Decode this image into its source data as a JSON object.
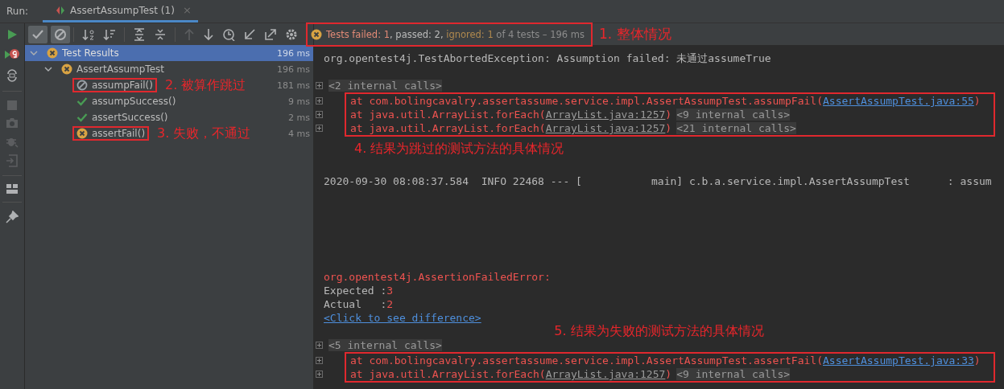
{
  "run_bar": {
    "label": "Run:",
    "tabs": [
      {
        "title": "AssertAssumpTest (1)",
        "close": "×",
        "selected": true
      }
    ]
  },
  "summary": {
    "framed": true,
    "segments": [
      {
        "kind": "failed",
        "text": "Tests failed: 1"
      },
      {
        "kind": "passed",
        "text": ", passed: 2,"
      },
      {
        "kind": "ignored",
        "text": " ignored: 1"
      },
      {
        "kind": "muted",
        "text": " of 4 tests – 196 ms"
      }
    ],
    "note": "1. 整体情况"
  },
  "toolbar": {
    "show_passed": true,
    "show_ignored": true
  },
  "tree": [
    {
      "name": "Test Results",
      "time": "196 ms",
      "kind": "failed",
      "selected": true,
      "expanded": true,
      "framed": false,
      "children": [
        {
          "name": "AssertAssumpTest",
          "time": "196 ms",
          "kind": "failed",
          "selected": false,
          "expanded": true,
          "framed": false,
          "children": [
            {
              "name": "assumpFail()",
              "time": "181 ms",
              "kind": "ignored",
              "selected": false,
              "framed": true,
              "note": "2. 被算作跳过"
            },
            {
              "name": "assumpSuccess()",
              "time": "9 ms",
              "kind": "passed",
              "selected": false,
              "framed": false
            },
            {
              "name": "assertSuccess()",
              "time": "2 ms",
              "kind": "passed",
              "selected": false,
              "framed": false
            },
            {
              "name": "assertFail()",
              "time": "4 ms",
              "kind": "failed",
              "selected": false,
              "framed": true,
              "note": "3. 失败，不通过"
            }
          ]
        }
      ]
    }
  ],
  "console": [
    {
      "kind": "line",
      "fold": false,
      "segments": [
        {
          "kind": "plain",
          "text": "org.opentest4j.TestAbortedException: Assumption failed: 未通过assumeTrue"
        }
      ]
    },
    {
      "kind": "blank"
    },
    {
      "kind": "line",
      "fold": true,
      "segments": [
        {
          "kind": "internal",
          "text": "<2 internal calls>"
        }
      ]
    },
    {
      "kind": "frame",
      "lines": [
        {
          "fold": true,
          "segments": [
            {
              "kind": "error",
              "text": "at com.bolingcavalry.assertassume.service.impl.AssertAssumpTest.assumpFail("
            },
            {
              "kind": "link",
              "text": "AssertAssumpTest.java:55"
            },
            {
              "kind": "error",
              "text": ")"
            }
          ]
        },
        {
          "fold": true,
          "segments": [
            {
              "kind": "error",
              "text": "at java.util.ArrayList.forEach("
            },
            {
              "kind": "file",
              "text": "ArrayList.java:1257"
            },
            {
              "kind": "error",
              "text": ")"
            },
            {
              "kind": "internal",
              "text": "<9 internal calls>"
            }
          ]
        },
        {
          "fold": true,
          "segments": [
            {
              "kind": "error",
              "text": "at java.util.ArrayList.forEach("
            },
            {
              "kind": "file",
              "text": "ArrayList.java:1257"
            },
            {
              "kind": "error",
              "text": ")"
            },
            {
              "kind": "internal",
              "text": "<21 internal calls>"
            }
          ]
        }
      ]
    },
    {
      "kind": "note",
      "text": "4. 结果为跳过的测试方法的具体情况"
    },
    {
      "kind": "blank"
    },
    {
      "kind": "line",
      "fold": false,
      "segments": [
        {
          "kind": "plain",
          "text": "2020-09-30 08:08:37.584  INFO 22468 --- [           main] c.b.a.service.impl.AssertAssumpTest      : assum"
        }
      ]
    },
    {
      "kind": "blank"
    },
    {
      "kind": "blank"
    },
    {
      "kind": "blank"
    },
    {
      "kind": "blank"
    },
    {
      "kind": "blank"
    },
    {
      "kind": "blank"
    },
    {
      "kind": "line",
      "fold": false,
      "segments": [
        {
          "kind": "error",
          "text": "org.opentest4j.AssertionFailedError:"
        }
      ]
    },
    {
      "kind": "line",
      "fold": false,
      "segments": [
        {
          "kind": "plain",
          "text": "Expected :"
        },
        {
          "kind": "error",
          "text": "3"
        }
      ]
    },
    {
      "kind": "line",
      "fold": false,
      "segments": [
        {
          "kind": "plain",
          "text": "Actual   :"
        },
        {
          "kind": "error",
          "text": "2"
        }
      ]
    },
    {
      "kind": "line",
      "fold": false,
      "segments": [
        {
          "kind": "link",
          "text": "<Click to see difference>"
        }
      ]
    },
    {
      "kind": "note",
      "text": "5. 结果为失败的测试方法的具体情况"
    },
    {
      "kind": "line",
      "fold": true,
      "segments": [
        {
          "kind": "internal",
          "text": "<5 internal calls>"
        }
      ]
    },
    {
      "kind": "frame",
      "lines": [
        {
          "fold": true,
          "segments": [
            {
              "kind": "error",
              "text": "at com.bolingcavalry.assertassume.service.impl.AssertAssumpTest.assertFail("
            },
            {
              "kind": "link",
              "text": "AssertAssumpTest.java:33"
            },
            {
              "kind": "error",
              "text": ")"
            }
          ]
        },
        {
          "fold": true,
          "segments": [
            {
              "kind": "error",
              "text": "at java.util.ArrayList.forEach("
            },
            {
              "kind": "file",
              "text": "ArrayList.java:1257"
            },
            {
              "kind": "error",
              "text": ")"
            },
            {
              "kind": "internal",
              "text": "<9 internal calls>"
            }
          ]
        }
      ]
    }
  ]
}
